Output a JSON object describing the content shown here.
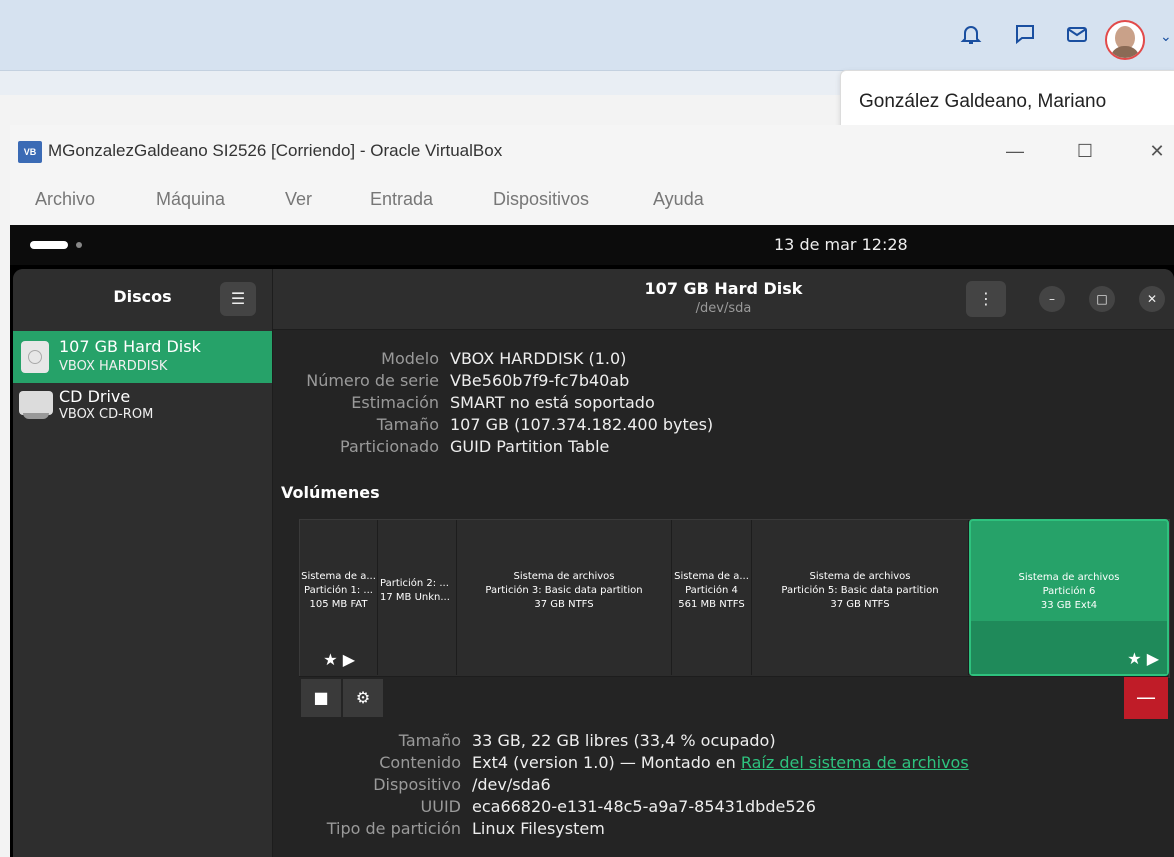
{
  "topbar": {
    "icons": [
      "bell-icon",
      "chat-icon",
      "mail-icon"
    ],
    "user_name": "González Galdeano, Mariano"
  },
  "window": {
    "title": "MGonzalezGaldeano SI2526 [Corriendo] - Oracle VirtualBox",
    "app_icon_text": "VB",
    "controls": {
      "minimize": "—",
      "maximize": "☐",
      "close": "✕"
    }
  },
  "menu": [
    "Archivo",
    "Máquina",
    "Ver",
    "Entrada",
    "Dispositivos",
    "Ayuda"
  ],
  "guest": {
    "clock": "13 de mar  12:28",
    "sidebar": {
      "title": "Discos",
      "drives": [
        {
          "name": "107 GB Hard Disk",
          "sub": "VBOX HARDDISK",
          "selected": true
        },
        {
          "name": "CD Drive",
          "sub": "VBOX CD-ROM",
          "selected": false
        }
      ]
    },
    "header": {
      "title": "107 GB Hard Disk",
      "subtitle": "/dev/sda"
    },
    "disk_info": {
      "labels": [
        "Modelo",
        "Número de serie",
        "Estimación",
        "Tamaño",
        "Particionado"
      ],
      "values": [
        "VBOX HARDDISK (1.0)",
        "VBe560b7f9-fc7b40ab",
        "SMART no está soportado",
        "107 GB (107.374.182.400 bytes)",
        "GUID Partition Table"
      ]
    },
    "volumes_title": "Volúmenes",
    "partitions": [
      {
        "lines": [
          "Sistema de a...",
          "Partición 1: ...",
          "105 MB FAT"
        ],
        "icons": "★ ▶"
      },
      {
        "lines": [
          "Partición 2: ...",
          "17 MB Unkn..."
        ]
      },
      {
        "lines": [
          "Sistema de archivos",
          "Partición 3: Basic data partition",
          "37 GB NTFS"
        ]
      },
      {
        "lines": [
          "Sistema de a...",
          "Partición 4",
          "561 MB NTFS"
        ]
      },
      {
        "lines": [
          "Sistema de archivos",
          "Partición 5: Basic data partition",
          "37 GB NTFS"
        ]
      },
      {
        "lines": [
          "Sistema de archivos",
          "Partición 6",
          "33 GB Ext4"
        ],
        "icons": "★ ▶",
        "selected": true
      }
    ],
    "tools": {
      "stop": "■",
      "settings": "⚙",
      "delete": "—"
    },
    "part_info": {
      "labels": [
        "Tamaño",
        "Contenido",
        "Dispositivo",
        "UUID",
        "Tipo de partición"
      ],
      "values": [
        "33 GB, 22 GB libres (33,4 % ocupado)",
        "Ext4 (version 1.0) — Montado en ",
        "/dev/sda6",
        "eca66820-e131-48c5-a9a7-85431dbde526",
        "Linux Filesystem"
      ],
      "mount_link": "Raíz del sistema de archivos"
    }
  }
}
